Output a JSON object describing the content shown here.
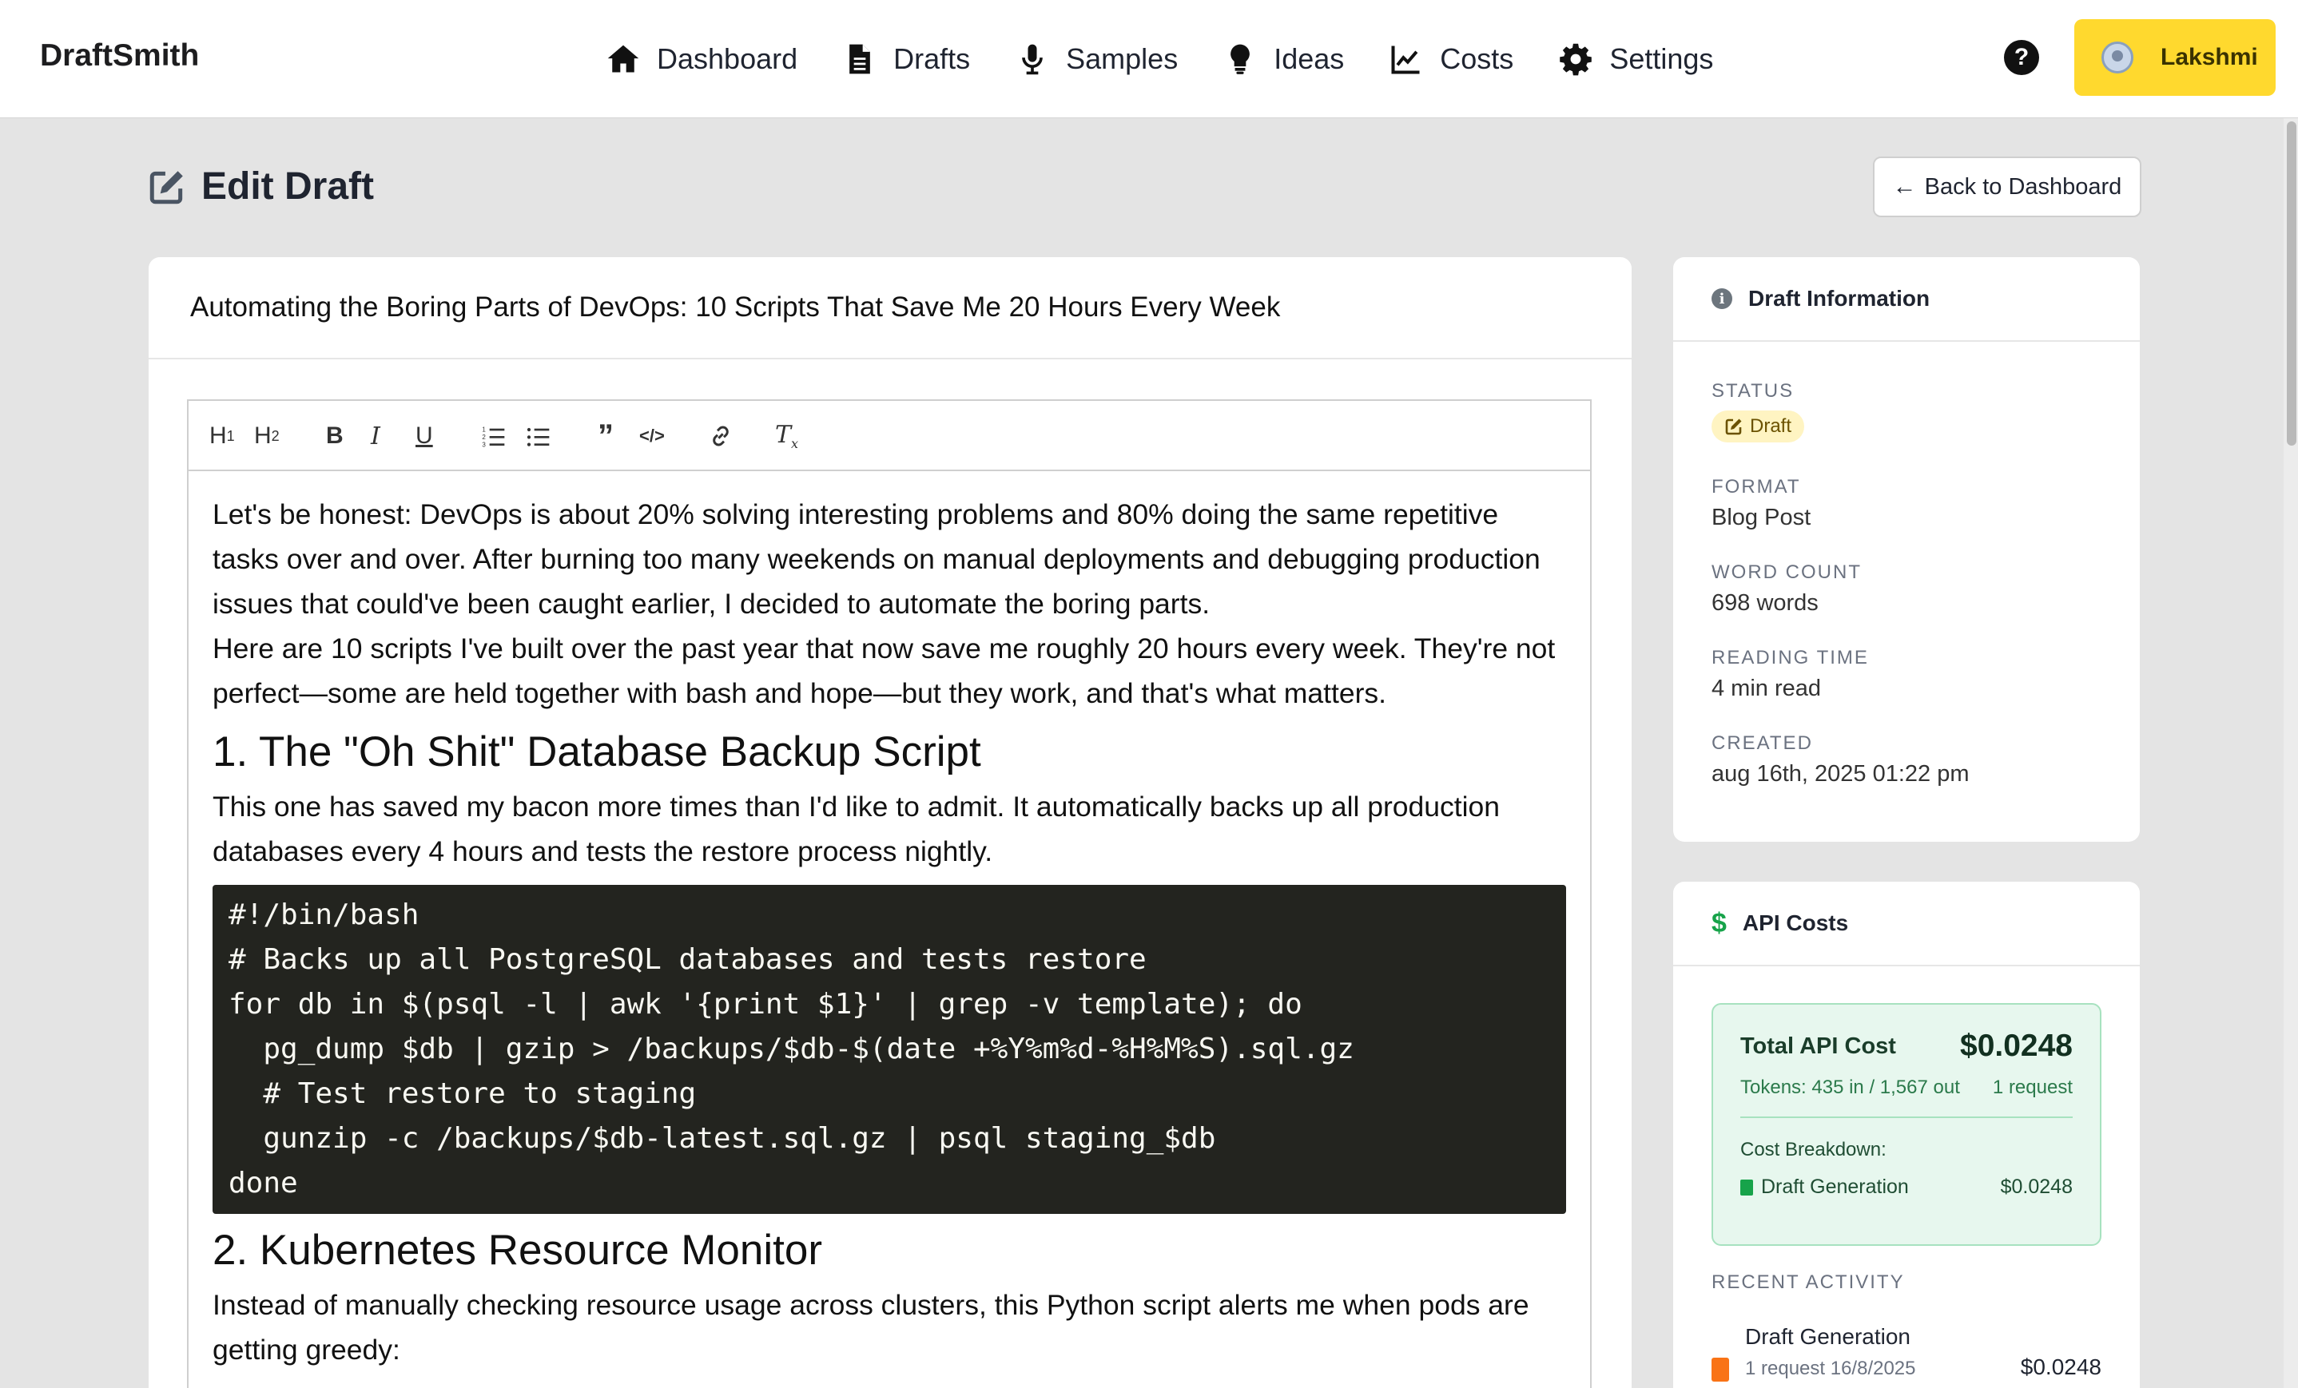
{
  "app": {
    "brand": "DraftSmith"
  },
  "nav": {
    "items": [
      {
        "label": "Dashboard",
        "icon": "home-icon"
      },
      {
        "label": "Drafts",
        "icon": "document-icon"
      },
      {
        "label": "Samples",
        "icon": "microphone-icon"
      },
      {
        "label": "Ideas",
        "icon": "lightbulb-icon"
      },
      {
        "label": "Costs",
        "icon": "line-chart-icon"
      },
      {
        "label": "Settings",
        "icon": "gear-icon"
      }
    ],
    "help_label": "?",
    "user_name": "Lakshmi"
  },
  "page": {
    "title": "Edit Draft",
    "back_label": "Back to Dashboard"
  },
  "editor": {
    "draft_title": "Automating the Boring Parts of DevOps: 10 Scripts That Save Me 20 Hours Every Week",
    "toolbar": [
      "H1",
      "H2",
      "B",
      "I",
      "U",
      "ordered-list",
      "bullet-list",
      "blockquote",
      "code",
      "link",
      "clear-format"
    ],
    "content": {
      "p1": "Let's be honest: DevOps is about 20% solving interesting problems and 80% doing the same repetitive tasks over and over. After burning too many weekends on manual deployments and debugging production issues that could've been caught earlier, I decided to automate the boring parts.",
      "p2": "Here are 10 scripts I've built over the past year that now save me roughly 20 hours every week. They're not perfect—some are held together with bash and hope—but they work, and that's what matters.",
      "h1": "1. The \"Oh Shit\" Database Backup Script",
      "p3": "This one has saved my bacon more times than I'd like to admit. It automatically backs up all production databases every 4 hours and tests the restore process nightly.",
      "code1": "#!/bin/bash\n# Backs up all PostgreSQL databases and tests restore\nfor db in $(psql -l | awk '{print $1}' | grep -v template); do\n  pg_dump $db | gzip > /backups/$db-$(date +%Y%m%d-%H%M%S).sql.gz\n  # Test restore to staging\n  gunzip -c /backups/$db-latest.sql.gz | psql staging_$db\ndone",
      "h2": "2. Kubernetes Resource Monitor",
      "p4": "Instead of manually checking resource usage across clusters, this Python script alerts me when pods are getting greedy:"
    }
  },
  "draft_info": {
    "heading": "Draft Information",
    "status_label": "STATUS",
    "status_value": "Draft",
    "format_label": "FORMAT",
    "format_value": "Blog Post",
    "word_count_label": "WORD COUNT",
    "word_count_value": "698 words",
    "reading_time_label": "READING TIME",
    "reading_time_value": "4 min read",
    "created_label": "CREATED",
    "created_value": "aug 16th, 2025 01:22 pm"
  },
  "api_costs": {
    "heading": "API Costs",
    "total_label": "Total API Cost",
    "total_value": "$0.0248",
    "tokens": "Tokens: 435 in / 1,567 out",
    "requests": "1 request",
    "breakdown_label": "Cost Breakdown:",
    "breakdown_item_label": "Draft Generation",
    "breakdown_item_value": "$0.0248",
    "recent_label": "RECENT ACTIVITY",
    "recent_title": "Draft Generation",
    "recent_sub": "1 request 16/8/2025",
    "recent_amount": "$0.0248"
  },
  "colors": {
    "accent_yellow": "#ffd92e",
    "cost_green": "#17a34a",
    "code_bg": "#23241f"
  }
}
